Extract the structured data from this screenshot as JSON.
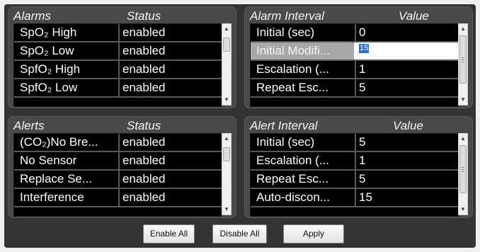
{
  "alarms_panel": {
    "header_name": "Alarms",
    "header_status": "Status",
    "rows": [
      {
        "name": "SpO₂ High",
        "status": "enabled"
      },
      {
        "name": "SpO₂ Low",
        "status": "enabled"
      },
      {
        "name": "SpfO₂ High",
        "status": "enabled"
      },
      {
        "name": "SpfO₂ Low",
        "status": "enabled"
      }
    ]
  },
  "alarm_interval_panel": {
    "header_name": "Alarm Interval",
    "header_value": "Value",
    "rows": [
      {
        "name": "Initial (sec)",
        "value": "0"
      },
      {
        "name": "Initial Modifi...",
        "value": "15"
      },
      {
        "name": "Escalation (...",
        "value": "1"
      },
      {
        "name": "Repeat Esc...",
        "value": "5"
      }
    ]
  },
  "alerts_panel": {
    "header_name": "Alerts",
    "header_status": "Status",
    "rows": [
      {
        "name": "(CO₂)No Bre...",
        "status": "enabled"
      },
      {
        "name": "No Sensor",
        "status": "enabled"
      },
      {
        "name": "Replace Se...",
        "status": "enabled"
      },
      {
        "name": "Interference",
        "status": "enabled"
      }
    ]
  },
  "alert_interval_panel": {
    "header_name": "Alert Interval",
    "header_value": "Value",
    "rows": [
      {
        "name": "Initial (sec)",
        "value": "5"
      },
      {
        "name": "Escalation (...",
        "value": "1"
      },
      {
        "name": "Repeat Esc...",
        "value": "5"
      },
      {
        "name": "Auto-discon...",
        "value": "15"
      }
    ]
  },
  "buttons": {
    "enable_all": "Enable All",
    "disable_all": "Disable All",
    "apply": "Apply"
  }
}
